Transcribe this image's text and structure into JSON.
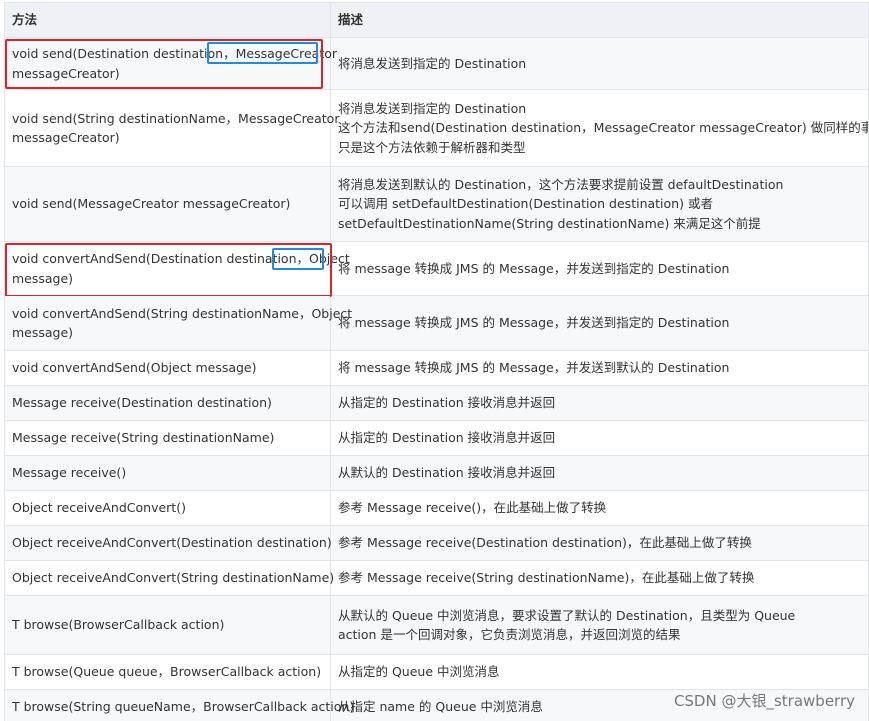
{
  "header": {
    "method": "方法",
    "description": "描述"
  },
  "rows": [
    {
      "m": [
        "void send(Destination destination，MessageCreator",
        "messageCreator)"
      ],
      "d": [
        "将消息发送到指定的 Destination"
      ]
    },
    {
      "m": [
        "void send(String destinationName，MessageCreator",
        "messageCreator)"
      ],
      "d": [
        "将消息发送到指定的 Destination",
        "这个方法和send(Destination destination，MessageCreator messageCreator) 做同样的事情,",
        "只是这个方法依赖于解析器和类型"
      ]
    },
    {
      "m": [
        "void send(MessageCreator messageCreator)"
      ],
      "d": [
        "将消息发送到默认的 Destination，这个方法要求提前设置 defaultDestination",
        "可以调用 setDefaultDestination(Destination destination) 或者",
        "setDefaultDestinationName(String destinationName) 来满足这个前提"
      ]
    },
    {
      "m": [
        "void convertAndSend(Destination destination，Object",
        "message)"
      ],
      "d": [
        "将 message 转换成 JMS 的 Message，并发送到指定的 Destination"
      ]
    },
    {
      "m": [
        "void convertAndSend(String destinationName，Object",
        "message)"
      ],
      "d": [
        "将 message 转换成 JMS 的 Message，并发送到指定的 Destination"
      ]
    },
    {
      "m": [
        "void convertAndSend(Object message)"
      ],
      "d": [
        "将 message 转换成 JMS 的 Message，并发送到默认的 Destination"
      ]
    },
    {
      "m": [
        "Message receive(Destination destination)"
      ],
      "d": [
        "从指定的 Destination 接收消息并返回"
      ]
    },
    {
      "m": [
        "Message receive(String destinationName)"
      ],
      "d": [
        "从指定的 Destination 接收消息并返回"
      ]
    },
    {
      "m": [
        "Message receive()"
      ],
      "d": [
        "从默认的 Destination 接收消息并返回"
      ]
    },
    {
      "m": [
        "Object receiveAndConvert()"
      ],
      "d": [
        "参考 Message receive()，在此基础上做了转换"
      ]
    },
    {
      "m": [
        "Object receiveAndConvert(Destination destination)"
      ],
      "d": [
        "参考 Message receive(Destination destination)，在此基础上做了转换"
      ]
    },
    {
      "m": [
        "Object receiveAndConvert(String destinationName)"
      ],
      "d": [
        "参考 Message receive(String destinationName)，在此基础上做了转换"
      ]
    },
    {
      "m": [
        "T browse(BrowserCallback action)"
      ],
      "d": [
        "从默认的 Queue 中浏览消息，要求设置了默认的 Destination，且类型为 Queue",
        "action 是一个回调对象，它负责浏览消息，并返回浏览的结果"
      ]
    },
    {
      "m": [
        "T browse(Queue queue，BrowserCallback action)"
      ],
      "d": [
        "从指定的 Queue 中浏览消息"
      ]
    },
    {
      "m": [
        "T browse(String queueName，BrowserCallback action)"
      ],
      "d": [
        "从指定 name 的 Queue 中浏览消息"
      ]
    }
  ],
  "watermark": "CSDN @大银_strawberry",
  "colors": {
    "red_highlight": "#d9232d",
    "blue_highlight": "#1e8fd6",
    "header_bg": "#eef2f6",
    "stripe_bg": "#f6f8fa"
  }
}
